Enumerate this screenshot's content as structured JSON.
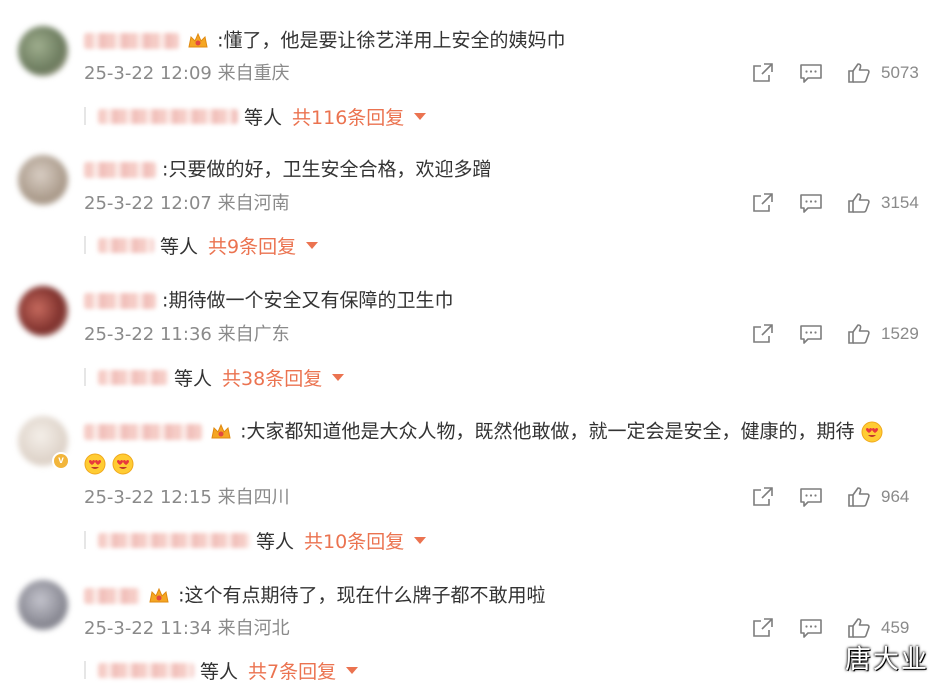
{
  "comments": [
    {
      "text": ":懂了，他是要让徐艺洋用上安全的姨妈巾",
      "time_location": "25-3-22 12:09 来自重庆",
      "likes": "5073",
      "reply_deng": "等人",
      "reply_total": "共116条回复",
      "avatar_color": "#7a8a6c"
    },
    {
      "text": ":只要做的好，卫生安全合格，欢迎多蹭",
      "time_location": "25-3-22 12:07 来自河南",
      "likes": "3154",
      "reply_deng": "等人",
      "reply_total": "共9条回复",
      "avatar_color": "#b9a99c"
    },
    {
      "text": ":期待做一个安全又有保障的卫生巾",
      "time_location": "25-3-22 11:36 来自广东",
      "likes": "1529",
      "reply_deng": "等人",
      "reply_total": "共38条回复",
      "avatar_color": "#8c3b38"
    },
    {
      "text": ":大家都知道他是大众人物，既然他敢做，就一定会是安全，健康的，期待",
      "time_location": "25-3-22 12:15 来自四川",
      "likes": "964",
      "reply_deng": "等人",
      "reply_total": "共10条回复",
      "avatar_color": "#e4dcd4"
    },
    {
      "text": ":这个有点期待了，现在什么牌子都不敢用啦",
      "time_location": "25-3-22 11:34 来自河北",
      "likes": "459",
      "reply_deng": "等人",
      "reply_total": "共7条回复",
      "avatar_color": "#9a9aa6"
    }
  ],
  "icons": {
    "share": "share-icon",
    "comment": "comment-icon",
    "like": "thumbs-up-icon",
    "crown": "crown-badge-icon",
    "emoji": "heart-eyes-emoji",
    "caret": "caret-down-icon"
  },
  "colors": {
    "reply_accent": "#eb7350",
    "meta_gray": "#8a8a8a",
    "text": "#333333"
  },
  "watermark": "唐大业"
}
